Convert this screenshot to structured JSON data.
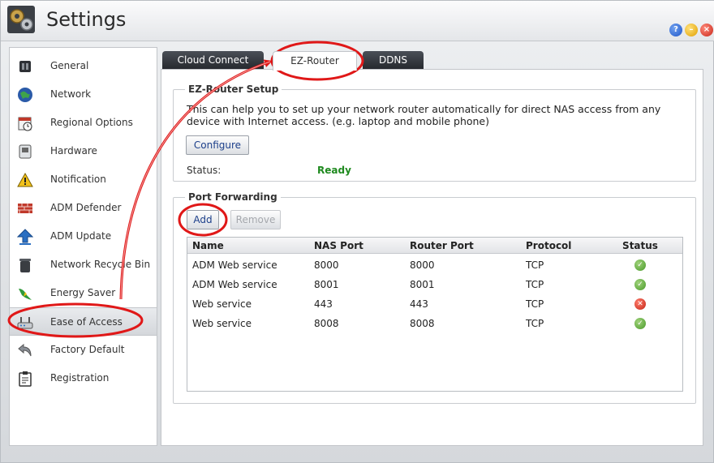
{
  "window": {
    "title": "Settings",
    "help_glyph": "?",
    "minimize_glyph": "–",
    "close_glyph": "×"
  },
  "sidebar": {
    "items": [
      {
        "label": "General",
        "icon": "general-icon"
      },
      {
        "label": "Network",
        "icon": "globe-icon"
      },
      {
        "label": "Regional Options",
        "icon": "calendar-clock-icon"
      },
      {
        "label": "Hardware",
        "icon": "hardware-icon"
      },
      {
        "label": "Notification",
        "icon": "warning-icon"
      },
      {
        "label": "ADM Defender",
        "icon": "firewall-icon"
      },
      {
        "label": "ADM Update",
        "icon": "up-arrow-icon"
      },
      {
        "label": "Network Recycle Bin",
        "icon": "trash-icon"
      },
      {
        "label": "Energy Saver",
        "icon": "energy-icon"
      },
      {
        "label": "Ease of Access",
        "icon": "router-icon",
        "selected": true
      },
      {
        "label": "Factory Default",
        "icon": "undo-icon"
      },
      {
        "label": "Registration",
        "icon": "clipboard-icon"
      }
    ]
  },
  "tabs": [
    {
      "label": "Cloud Connect"
    },
    {
      "label": "EZ-Router",
      "active": true
    },
    {
      "label": "DDNS"
    }
  ],
  "setup": {
    "legend": "EZ-Router Setup",
    "description": "This can help you to set up your network router automatically for direct NAS access from any device with Internet access. (e.g. laptop and mobile phone)",
    "configure_label": "Configure",
    "status_label": "Status:",
    "status_value": "Ready",
    "status_color": "#1f8a1f"
  },
  "forwarding": {
    "legend": "Port Forwarding",
    "add_label": "Add",
    "remove_label": "Remove",
    "columns": [
      "Name",
      "NAS Port",
      "Router Port",
      "Protocol",
      "Status"
    ],
    "rows": [
      {
        "name": "ADM Web service",
        "nas_port": "8000",
        "router_port": "8000",
        "protocol": "TCP",
        "status": "ok"
      },
      {
        "name": "ADM Web service",
        "nas_port": "8001",
        "router_port": "8001",
        "protocol": "TCP",
        "status": "ok"
      },
      {
        "name": "Web service",
        "nas_port": "443",
        "router_port": "443",
        "protocol": "TCP",
        "status": "error"
      },
      {
        "name": "Web service",
        "nas_port": "8008",
        "router_port": "8008",
        "protocol": "TCP",
        "status": "ok"
      }
    ]
  },
  "annotation_color": "#e01818"
}
